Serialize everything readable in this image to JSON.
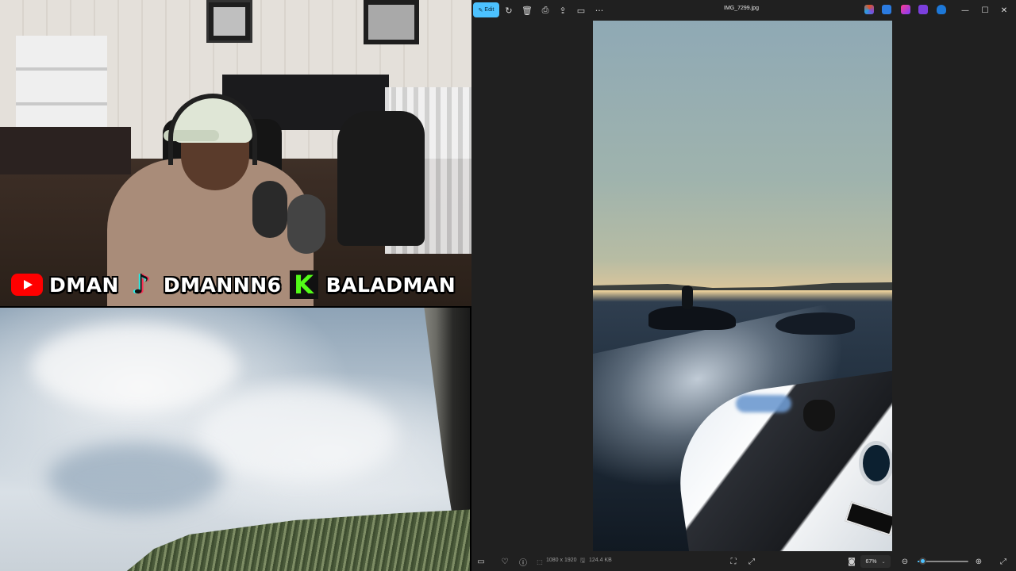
{
  "webcam": {
    "socials": [
      {
        "platform": "youtube",
        "icon": "youtube-icon",
        "handle": "DMAN"
      },
      {
        "platform": "tiktok",
        "icon": "tiktok-icon",
        "handle": "DMANNN6"
      },
      {
        "platform": "kick",
        "icon": "kick-icon",
        "handle": "BALADMAN",
        "glyph": "K"
      }
    ]
  },
  "viewer": {
    "toolbar": {
      "edit_label": "Edit",
      "edit_icon": "edit-pencil-icon",
      "icons": [
        "rotate-icon",
        "delete-icon",
        "print-icon",
        "share-icon",
        "slideshow-icon",
        "more-icon"
      ],
      "more_label": "···"
    },
    "file_name": "IMG_7299.jpg",
    "app_icons": [
      "copilot-icon",
      "editor-icon",
      "designer-icon",
      "clipchamp-icon",
      "onedrive-icon"
    ],
    "window": {
      "minimize": "—",
      "maximize": "☐",
      "close": "✕"
    },
    "bottom_bar": {
      "dimensions": "1080 x 1920",
      "file_size": "124.4 KB",
      "zoom_label": "67%",
      "zoom_level": 0.1
    },
    "colors": {
      "accent": "#4cc2ff",
      "background": "#202020"
    }
  }
}
